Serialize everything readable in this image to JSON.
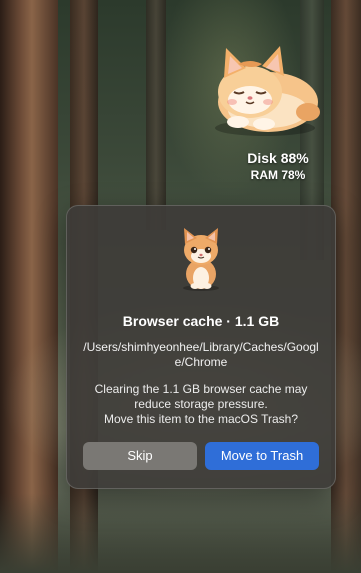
{
  "widget": {
    "disk_label": "Disk 88%",
    "ram_label": "RAM 78%",
    "cat_icon": "sleeping-cat-icon"
  },
  "dialog": {
    "icon": "kitten-icon",
    "title": "Browser cache · 1.1 GB",
    "path": "/Users/shimhyeonhee/Library/Caches/Google/Chrome",
    "message_line1": "Clearing the 1.1 GB browser cache may",
    "message_line2": "reduce storage pressure.",
    "message_line3": "Move this item to the macOS Trash?",
    "skip_label": "Skip",
    "trash_label": "Move to Trash",
    "colors": {
      "primary": "#2f6ed8",
      "secondary": "#7a7874"
    }
  }
}
